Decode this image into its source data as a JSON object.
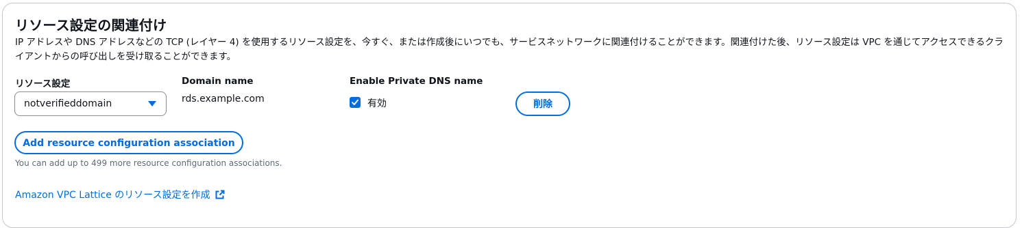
{
  "section": {
    "title": "リソース設定の関連付け",
    "description": "IP アドレスや DNS アドレスなどの TCP (レイヤー 4) を使用するリソース設定を、今すぐ、または作成後にいつでも、サービスネットワークに関連付けることができます。関連付けた後、リソース設定は VPC を通じてアクセスできるクライアントからの呼び出しを受け取ることができます。"
  },
  "columns": {
    "resource_config": "リソース設定",
    "domain_name": "Domain name",
    "private_dns": "Enable Private DNS name"
  },
  "row": {
    "resource_config_value": "notverifieddomain",
    "domain_name_value": "rds.example.com",
    "private_dns_checked": true,
    "private_dns_label": "有効",
    "delete_label": "削除"
  },
  "add_button_label": "Add resource configuration association",
  "hint": "You can add up to 499 more resource configuration associations.",
  "external_link_label": "Amazon VPC Lattice のリソース設定を作成",
  "colors": {
    "accent": "#006ce0",
    "text": "#0f141a",
    "muted": "#5f6b7a",
    "border": "#c6c6cd"
  }
}
